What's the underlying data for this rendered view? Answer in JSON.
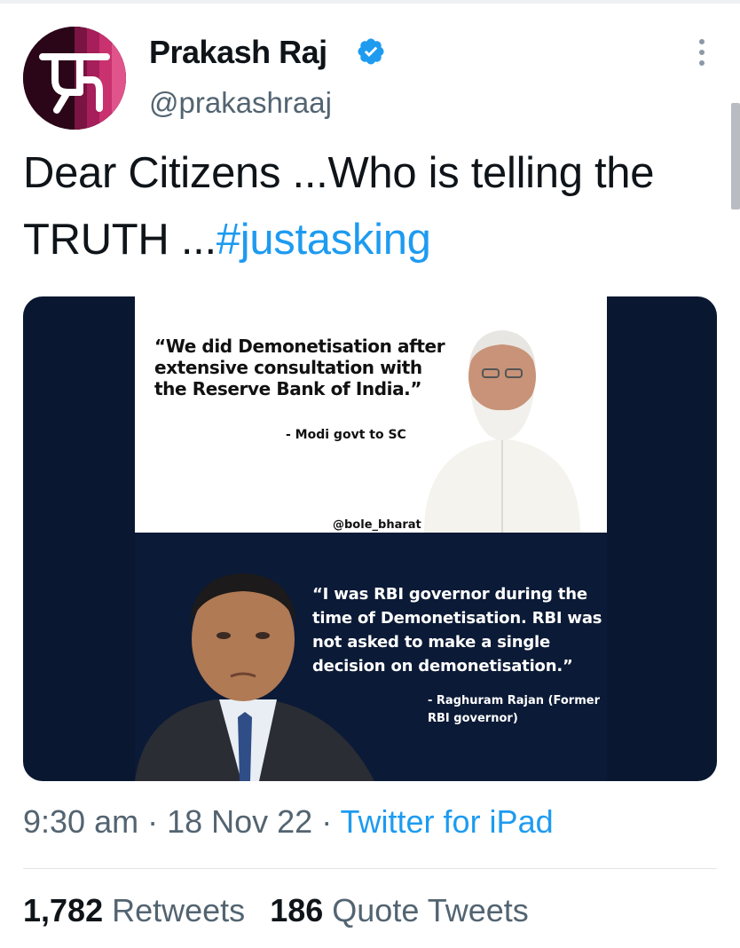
{
  "author": {
    "name": "Prakash Raj",
    "handle": "@prakashraaj",
    "avatar_glyph": "ᥲ"
  },
  "tweet": {
    "text_part": "Dear Citizens ...Who is telling the TRUTH ...",
    "hashtag": "#justasking"
  },
  "media": {
    "quote_top": "“We did Demonetisation after extensive consultation with the Reserve Bank of India.”",
    "attribution_top": "- Modi govt to SC",
    "credit": "@bole_bharat",
    "quote_bottom": "“I was RBI governor during the time of Demonetisation. RBI was not asked to make a single decision on demonetisation.”",
    "attribution_bottom": "- Raghuram Rajan (Former RBI governor)"
  },
  "meta": {
    "time": "9:30 am",
    "separator": " · ",
    "date": "18 Nov 22",
    "source": "Twitter for iPad"
  },
  "stats": {
    "retweets_count": "1,782",
    "retweets_label": "Retweets",
    "quotes_count": "186",
    "quotes_label": "Quote Tweets"
  },
  "colors": {
    "accent": "#1d9bf0",
    "secondary_text": "#536471",
    "media_bg": "#0a1730"
  },
  "icons": [
    "verified-badge-icon",
    "more-options-icon"
  ]
}
